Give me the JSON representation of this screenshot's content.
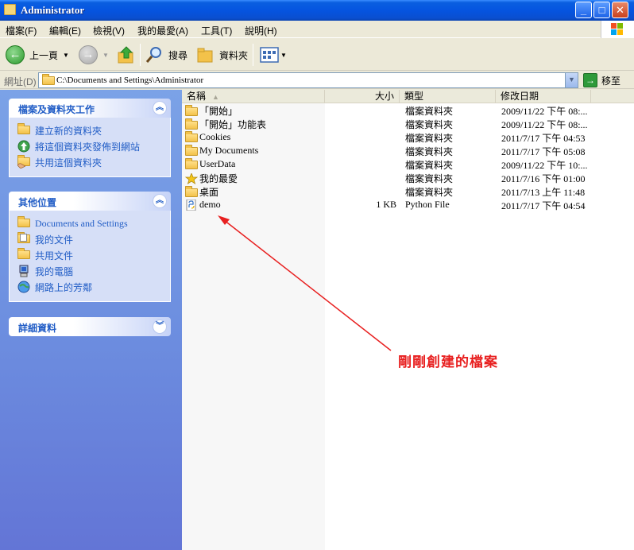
{
  "window": {
    "title": "Administrator",
    "controls": {
      "minimize": "_",
      "maximize": "□",
      "close": "✕"
    }
  },
  "menubar": {
    "items": [
      "檔案(F)",
      "編輯(E)",
      "檢視(V)",
      "我的最愛(A)",
      "工具(T)",
      "說明(H)"
    ]
  },
  "toolbar": {
    "back_label": "上一頁",
    "search_label": "搜尋",
    "folders_label": "資料夾"
  },
  "address": {
    "label": "網址(D)",
    "path": "C:\\Documents and Settings\\Administrator",
    "go_label": "移至"
  },
  "sidebar": {
    "panels": [
      {
        "title": "檔案及資料夾工作",
        "items": [
          {
            "label": "建立新的資料夾",
            "icon": "new-folder-icon"
          },
          {
            "label": "將這個資料夾發佈到網站",
            "icon": "publish-web-icon"
          },
          {
            "label": "共用這個資料夾",
            "icon": "share-folder-icon"
          }
        ]
      },
      {
        "title": "其他位置",
        "items": [
          {
            "label": "Documents and Settings",
            "icon": "folder-icon"
          },
          {
            "label": "我的文件",
            "icon": "my-documents-icon"
          },
          {
            "label": "共用文件",
            "icon": "shared-documents-icon"
          },
          {
            "label": "我的電腦",
            "icon": "my-computer-icon"
          },
          {
            "label": "網路上的芳鄰",
            "icon": "network-places-icon"
          }
        ]
      },
      {
        "title": "詳細資料",
        "items": []
      }
    ]
  },
  "filelist": {
    "columns": [
      "名稱",
      "大小",
      "類型",
      "修改日期"
    ],
    "rows": [
      {
        "name": "「開始」",
        "size": "",
        "type": "檔案資料夾",
        "date": "2009/11/22 下午 08:...",
        "icon": "folder-icon"
      },
      {
        "name": "「開始」功能表",
        "size": "",
        "type": "檔案資料夾",
        "date": "2009/11/22 下午 08:...",
        "icon": "folder-icon"
      },
      {
        "name": "Cookies",
        "size": "",
        "type": "檔案資料夾",
        "date": "2011/7/17 下午 04:53",
        "icon": "folder-icon"
      },
      {
        "name": "My Documents",
        "size": "",
        "type": "檔案資料夾",
        "date": "2011/7/17 下午 05:08",
        "icon": "folder-icon"
      },
      {
        "name": "UserData",
        "size": "",
        "type": "檔案資料夾",
        "date": "2009/11/22 下午 10:...",
        "icon": "folder-icon"
      },
      {
        "name": "我的最愛",
        "size": "",
        "type": "檔案資料夾",
        "date": "2011/7/16 下午 01:00",
        "icon": "favorites-star-icon"
      },
      {
        "name": "桌面",
        "size": "",
        "type": "檔案資料夾",
        "date": "2011/7/13 上午 11:48",
        "icon": "folder-icon"
      },
      {
        "name": "demo",
        "size": "1 KB",
        "type": "Python File",
        "date": "2011/7/17 下午 04:54",
        "icon": "python-file-icon"
      }
    ]
  },
  "annotation": {
    "text": "剛剛創建的檔案",
    "color": "#E82020"
  },
  "colors": {
    "titlebar": "#0554E0",
    "taskpane": "#6D8FE0",
    "link": "#215DC6"
  }
}
